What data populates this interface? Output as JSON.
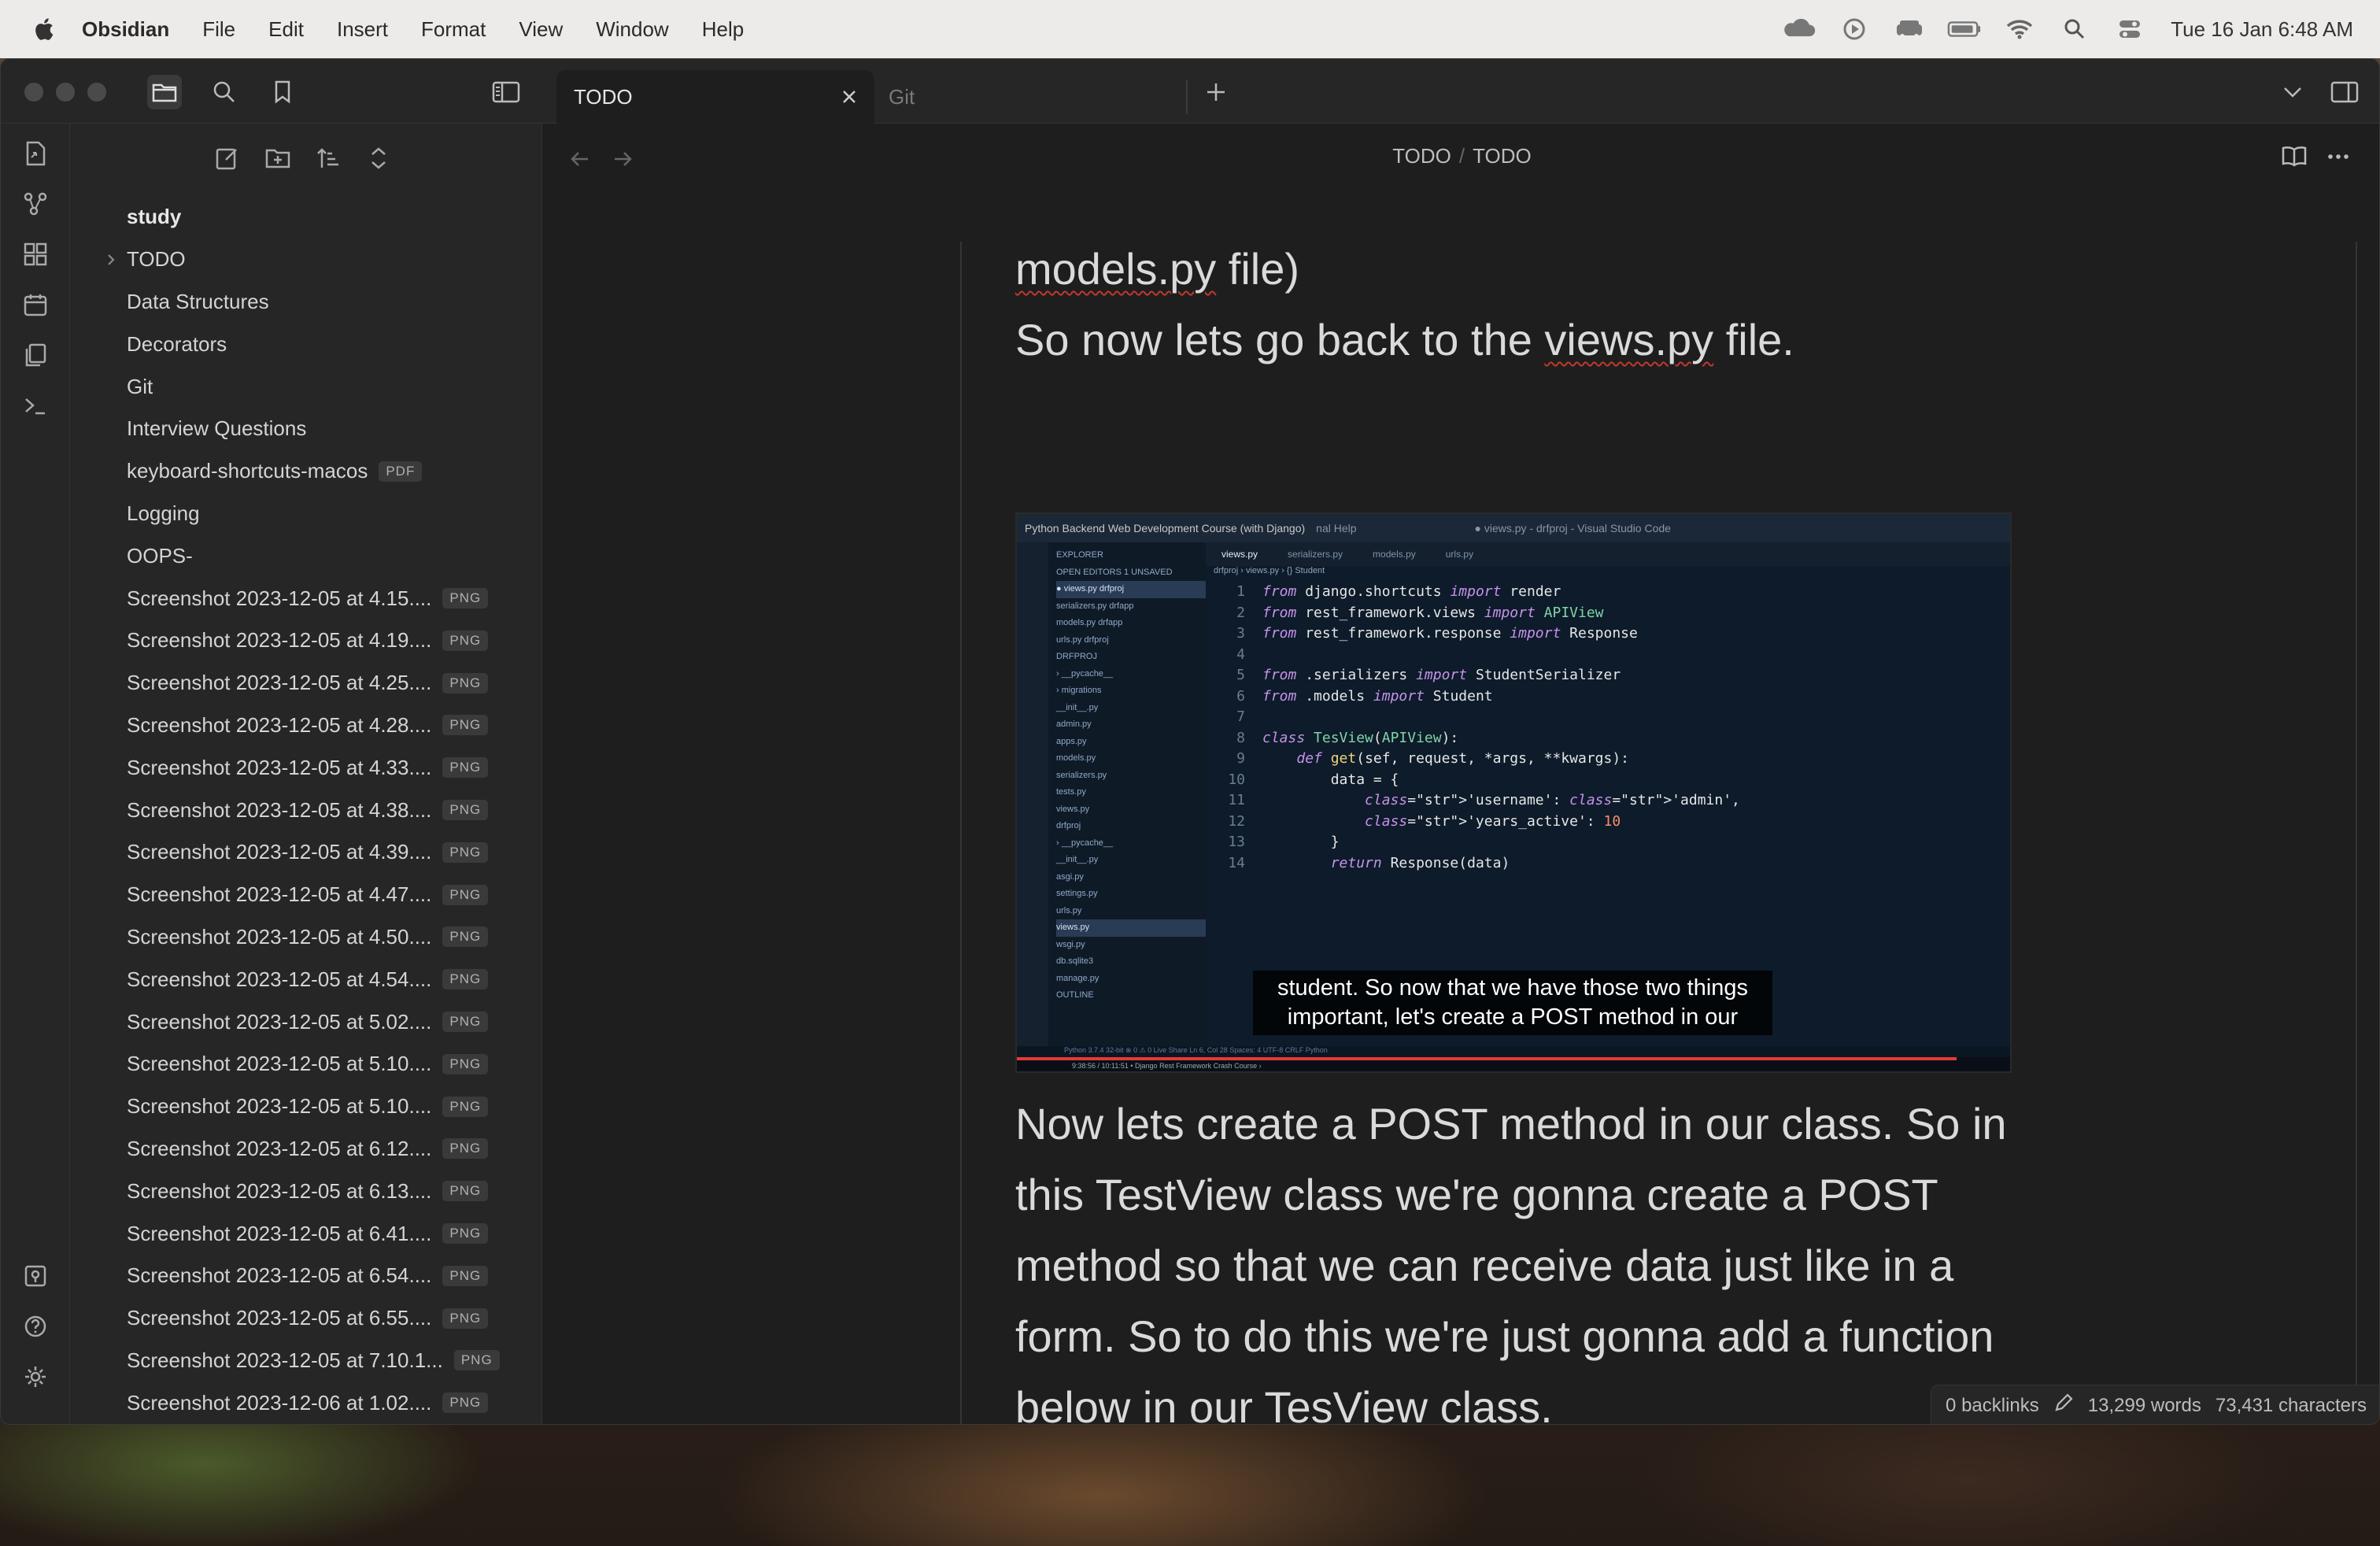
{
  "menubar": {
    "app_name": "Obsidian",
    "items": [
      "File",
      "Edit",
      "Insert",
      "Format",
      "View",
      "Window",
      "Help"
    ],
    "clock": "Tue 16 Jan  6:48 AM"
  },
  "tabs": {
    "active_label": "TODO",
    "inactive_label": "Git"
  },
  "sidebar": {
    "items": [
      {
        "label": "study",
        "badge": ""
      },
      {
        "label": "TODO",
        "badge": ""
      },
      {
        "label": "Data Structures",
        "badge": ""
      },
      {
        "label": "Decorators",
        "badge": ""
      },
      {
        "label": "Git",
        "badge": ""
      },
      {
        "label": "Interview Questions",
        "badge": ""
      },
      {
        "label": "keyboard-shortcuts-macos",
        "badge": "PDF"
      },
      {
        "label": "Logging",
        "badge": ""
      },
      {
        "label": "OOPS-",
        "badge": ""
      },
      {
        "label": "Screenshot 2023-12-05 at 4.15....",
        "badge": "PNG"
      },
      {
        "label": "Screenshot 2023-12-05 at 4.19....",
        "badge": "PNG"
      },
      {
        "label": "Screenshot 2023-12-05 at 4.25....",
        "badge": "PNG"
      },
      {
        "label": "Screenshot 2023-12-05 at 4.28....",
        "badge": "PNG"
      },
      {
        "label": "Screenshot 2023-12-05 at 4.33....",
        "badge": "PNG"
      },
      {
        "label": "Screenshot 2023-12-05 at 4.38....",
        "badge": "PNG"
      },
      {
        "label": "Screenshot 2023-12-05 at 4.39....",
        "badge": "PNG"
      },
      {
        "label": "Screenshot 2023-12-05 at 4.47....",
        "badge": "PNG"
      },
      {
        "label": "Screenshot 2023-12-05 at 4.50....",
        "badge": "PNG"
      },
      {
        "label": "Screenshot 2023-12-05 at 4.54....",
        "badge": "PNG"
      },
      {
        "label": "Screenshot 2023-12-05 at 5.02....",
        "badge": "PNG"
      },
      {
        "label": "Screenshot 2023-12-05 at 5.10....",
        "badge": "PNG"
      },
      {
        "label": "Screenshot 2023-12-05 at 5.10....",
        "badge": "PNG"
      },
      {
        "label": "Screenshot 2023-12-05 at 6.12....",
        "badge": "PNG"
      },
      {
        "label": "Screenshot 2023-12-05 at 6.13....",
        "badge": "PNG"
      },
      {
        "label": "Screenshot 2023-12-05 at 6.41....",
        "badge": "PNG"
      },
      {
        "label": "Screenshot 2023-12-05 at 6.54....",
        "badge": "PNG"
      },
      {
        "label": "Screenshot 2023-12-05 at 6.55....",
        "badge": "PNG"
      },
      {
        "label": "Screenshot 2023-12-05 at 7.10.1...",
        "badge": "PNG"
      },
      {
        "label": "Screenshot 2023-12-06 at 1.02....",
        "badge": "PNG"
      }
    ]
  },
  "main": {
    "breadcrumb_folder": "TODO",
    "breadcrumb_sep": "/",
    "breadcrumb_file": "TODO",
    "top_line1": "models.py",
    "top_line1_rest": " file)",
    "top_line2_a": "So now lets go back to the ",
    "top_line2_b": "views.py",
    "top_line2_c": " file.",
    "para_a": "Now lets create a POST method in our class. So in this TestView class we're gonna create a POST method so that we can receive data just like in a form. So to do this we're just gonna add a function below in our ",
    "para_b": "TesView",
    "para_c": " class."
  },
  "embed": {
    "title": "Python Backend Web Development Course (with Django)",
    "menu": "nal  Help",
    "window_path": "● views.py - drfproj - Visual Studio Code",
    "tabs": [
      "views.py",
      "serializers.py",
      "models.py",
      "urls.py"
    ],
    "crumb": "drfproj › views.py › {} Student",
    "explorer": [
      "EXPLORER",
      "OPEN EDITORS  1 UNSAVED",
      "● views.py drfproj",
      "serializers.py drfapp",
      "models.py drfapp",
      "urls.py drfproj",
      "DRFPROJ",
      "› __pycache__",
      "› migrations",
      "__init__.py",
      "admin.py",
      "apps.py",
      "models.py",
      "serializers.py",
      "tests.py",
      "views.py",
      "drfproj",
      "› __pycache__",
      "__init__.py",
      "asgi.py",
      "settings.py",
      "urls.py",
      "views.py",
      "wsgi.py",
      "db.sqlite3",
      "manage.py",
      "OUTLINE"
    ],
    "code": [
      {
        "n": "1",
        "t": "from django.shortcuts import render"
      },
      {
        "n": "2",
        "t": "from rest_framework.views import APIView"
      },
      {
        "n": "3",
        "t": "from rest_framework.response import Response"
      },
      {
        "n": "4",
        "t": ""
      },
      {
        "n": "5",
        "t": "from .serializers import StudentSerializer"
      },
      {
        "n": "6",
        "t": "from .models import Student"
      },
      {
        "n": "7",
        "t": ""
      },
      {
        "n": "8",
        "t": "class TesView(APIView):"
      },
      {
        "n": "9",
        "t": "    def get(sef, request, *args, **kwargs):"
      },
      {
        "n": "10",
        "t": "        data = {"
      },
      {
        "n": "11",
        "t": "            'username': 'admin',"
      },
      {
        "n": "12",
        "t": "            'years_active': 10"
      },
      {
        "n": "13",
        "t": "        }"
      },
      {
        "n": "14",
        "t": "        return Response(data)"
      }
    ],
    "subtitle_line1": "student. So now that we have those two things",
    "subtitle_line2": "important, let's create a POST method in our",
    "status": "Python 3.7.4 32-bit   ⊗ 0 ⚠ 0   Live Share                    Ln 6, Col 28   Spaces: 4   UTF-8   CRLF   Python",
    "video_time": "9:38:56 / 10:11:51 • Django Rest Framework Crash Course ›",
    "progress_fraction": 0.946
  },
  "status": {
    "backlinks": "0 backlinks",
    "words": "13,299 words",
    "characters": "73,431 characters"
  },
  "colors": {
    "accent": "#c792ea",
    "spell_error": "#c0392b"
  }
}
